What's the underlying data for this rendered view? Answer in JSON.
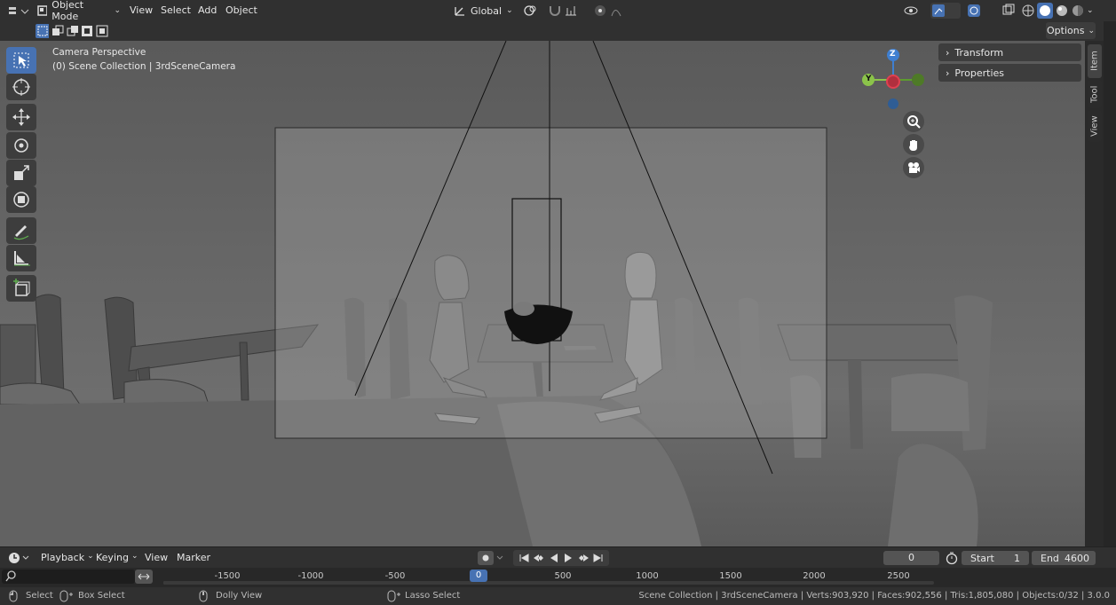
{
  "header": {
    "mode": "Object Mode",
    "menus": [
      "View",
      "Select",
      "Add",
      "Object"
    ],
    "orientation": "Global",
    "options": "Options"
  },
  "viewport": {
    "camera_label": "Camera Perspective",
    "collection_label": "(0) Scene Collection | 3rdSceneCamera"
  },
  "gizmo": {
    "z": "Z",
    "y": "Y"
  },
  "sidebar": {
    "panels": [
      "Transform",
      "Properties"
    ],
    "tabs": [
      "Item",
      "Tool",
      "View"
    ]
  },
  "timeline": {
    "menus": [
      "Playback",
      "Keying",
      "View",
      "Marker"
    ],
    "current_frame": "0",
    "start_label": "Start",
    "start_value": "1",
    "end_label": "End",
    "end_value": "4600",
    "ticks": [
      "-1500",
      "-1000",
      "-500",
      "0",
      "500",
      "1000",
      "1500",
      "2000",
      "2500"
    ]
  },
  "statusbar": {
    "select": "Select",
    "box_select": "Box Select",
    "dolly": "Dolly View",
    "lasso": "Lasso Select",
    "info": "Scene Collection | 3rdSceneCamera | Verts:903,920 | Faces:902,556 | Tris:1,805,080 | Objects:0/32 | 3.0.0"
  }
}
